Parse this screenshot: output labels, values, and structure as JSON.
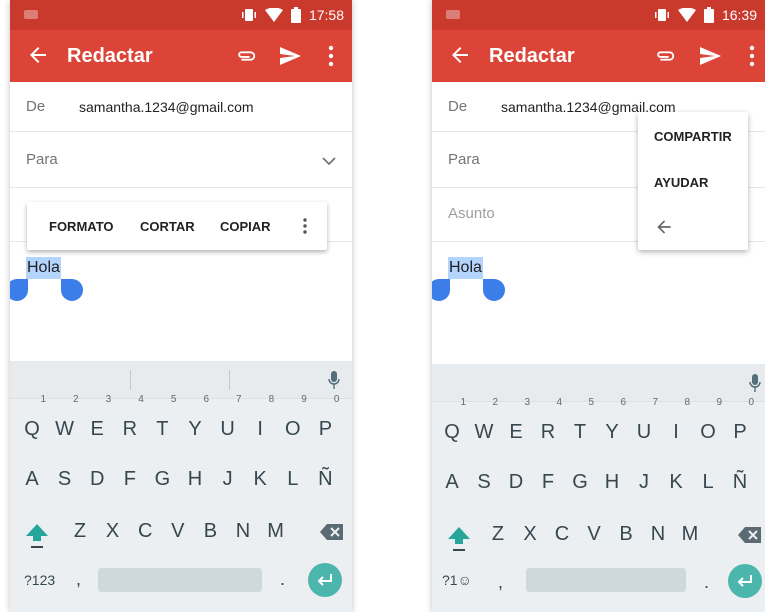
{
  "left": {
    "time": "17:58",
    "app_title": "Redactar",
    "from_label": "De",
    "from_value": "samantha.1234@gmail.com",
    "to_label": "Para",
    "selected_text": "Hola",
    "selection_toolbar": {
      "format": "FORMATO",
      "cut": "CORTAR",
      "copy": "COPIAR"
    },
    "keyboard": {
      "row1": [
        {
          "k": "Q",
          "n": "1"
        },
        {
          "k": "W",
          "n": "2"
        },
        {
          "k": "E",
          "n": "3"
        },
        {
          "k": "R",
          "n": "4"
        },
        {
          "k": "T",
          "n": "5"
        },
        {
          "k": "Y",
          "n": "6"
        },
        {
          "k": "U",
          "n": "7"
        },
        {
          "k": "I",
          "n": "8"
        },
        {
          "k": "O",
          "n": "9"
        },
        {
          "k": "P",
          "n": "0"
        }
      ],
      "row2": [
        "A",
        "S",
        "D",
        "F",
        "G",
        "H",
        "J",
        "K",
        "L",
        "Ñ"
      ],
      "row3": [
        "Z",
        "X",
        "C",
        "V",
        "B",
        "N",
        "M"
      ],
      "symbols": "?123",
      "comma": ",",
      "period": "."
    }
  },
  "right": {
    "time": "16:39",
    "app_title": "Redactar",
    "from_label": "De",
    "from_value": "samantha.1234@gmail.com",
    "to_label": "Para",
    "subject_placeholder": "Asunto",
    "selected_text": "Hola",
    "overflow_menu": {
      "share": "COMPARTIR",
      "help": "AYUDAR"
    },
    "keyboard": {
      "row1": [
        {
          "k": "Q",
          "n": "1"
        },
        {
          "k": "W",
          "n": "2"
        },
        {
          "k": "E",
          "n": "3"
        },
        {
          "k": "R",
          "n": "4"
        },
        {
          "k": "T",
          "n": "5"
        },
        {
          "k": "Y",
          "n": "6"
        },
        {
          "k": "U",
          "n": "7"
        },
        {
          "k": "I",
          "n": "8"
        },
        {
          "k": "O",
          "n": "9"
        },
        {
          "k": "P",
          "n": "0"
        }
      ],
      "row2": [
        "A",
        "S",
        "D",
        "F",
        "G",
        "H",
        "J",
        "K",
        "L",
        "Ñ"
      ],
      "row3": [
        "Z",
        "X",
        "C",
        "V",
        "B",
        "N",
        "M"
      ],
      "symbols": "?1☺",
      "comma": ",",
      "period": "."
    }
  },
  "colors": {
    "statusbar": "#c9392c",
    "appbar": "#db4437",
    "accent": "#4db6ac",
    "handle": "#3b7de9",
    "selection": "#b3d4fc"
  }
}
